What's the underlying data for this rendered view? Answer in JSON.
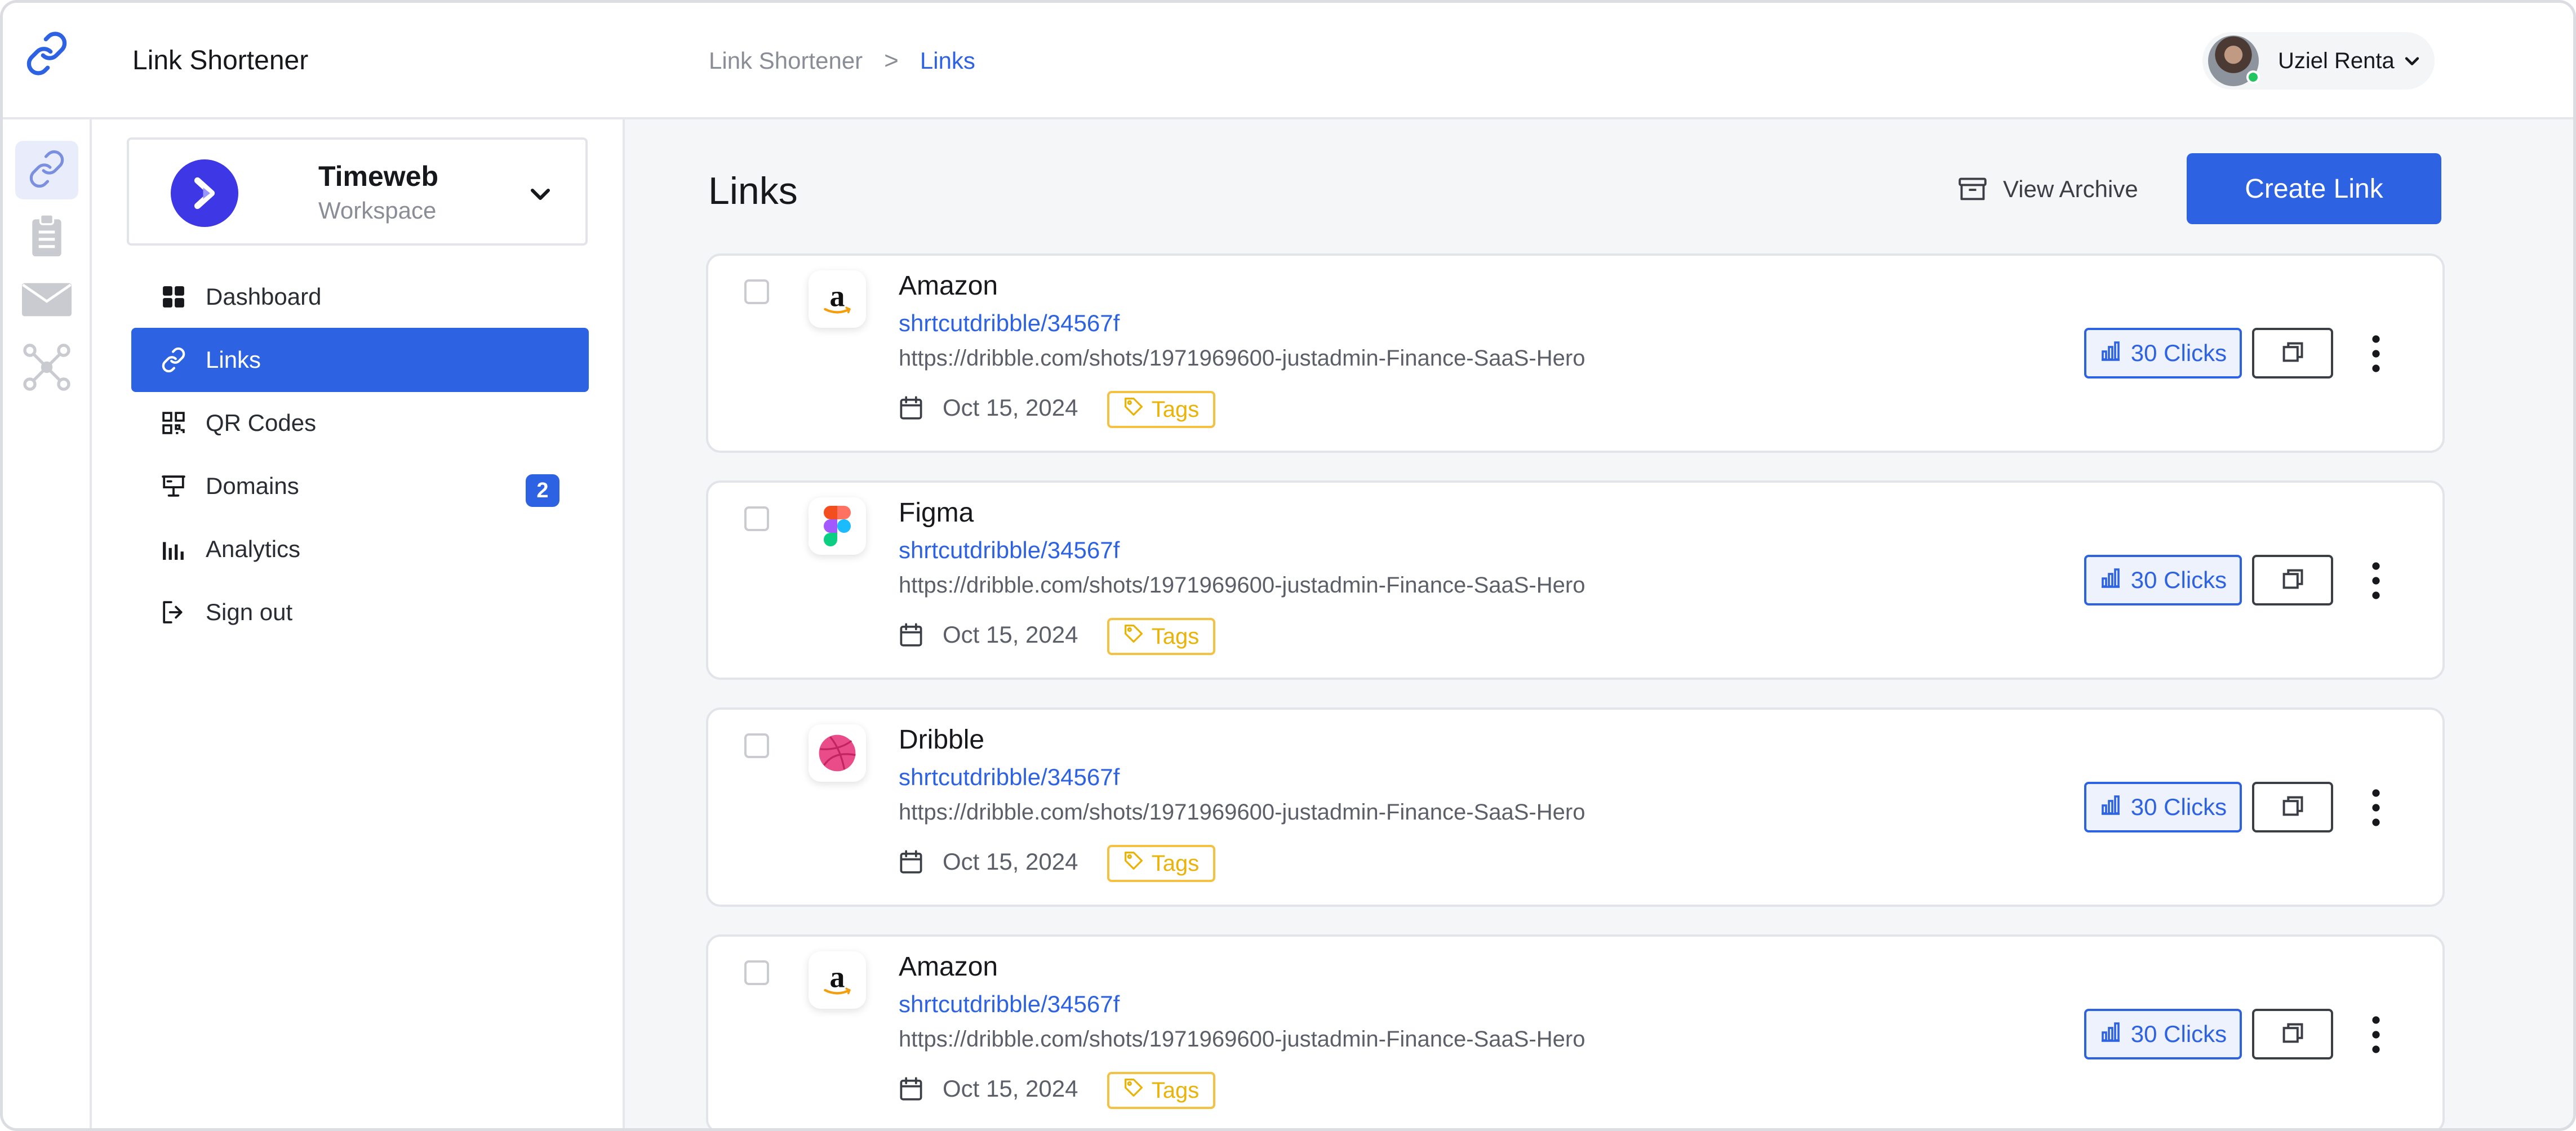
{
  "app": {
    "title": "Link Shortener"
  },
  "breadcrumb": {
    "root": "Link Shortener",
    "separator": ">",
    "current": "Links"
  },
  "user": {
    "name": "Uziel Renta",
    "status": "online"
  },
  "rail": {
    "items": [
      "link-icon",
      "clipboard-icon",
      "mail-icon",
      "network-icon"
    ]
  },
  "workspace": {
    "name": "Timeweb",
    "subtitle": "Workspace"
  },
  "sidebar": {
    "items": [
      {
        "label": "Dashboard",
        "icon": "grid-icon"
      },
      {
        "label": "Links",
        "icon": "link-icon",
        "active": true
      },
      {
        "label": "QR Codes",
        "icon": "qr-icon"
      },
      {
        "label": "Domains",
        "icon": "domain-icon",
        "badge": "2"
      },
      {
        "label": "Analytics",
        "icon": "bar-chart-icon"
      },
      {
        "label": "Sign out",
        "icon": "sign-out-icon"
      }
    ]
  },
  "main": {
    "title": "Links",
    "archive_label": "View Archive",
    "create_label": "Create Link"
  },
  "links": [
    {
      "name": "Amazon",
      "short": "shrtcutdribble/34567f",
      "url": "https://dribble.com/shots/1971969600-justadmin-Finance-SaaS-Hero",
      "date": "Oct 15, 2024",
      "tag": "Tags",
      "clicks": "30 Clicks",
      "icon": "amazon-icon"
    },
    {
      "name": "Figma",
      "short": "shrtcutdribble/34567f",
      "url": "https://dribble.com/shots/1971969600-justadmin-Finance-SaaS-Hero",
      "date": "Oct 15, 2024",
      "tag": "Tags",
      "clicks": "30 Clicks",
      "icon": "figma-icon"
    },
    {
      "name": "Dribble",
      "short": "shrtcutdribble/34567f",
      "url": "https://dribble.com/shots/1971969600-justadmin-Finance-SaaS-Hero",
      "date": "Oct 15, 2024",
      "tag": "Tags",
      "clicks": "30 Clicks",
      "icon": "dribbble-icon"
    },
    {
      "name": "Amazon",
      "short": "shrtcutdribble/34567f",
      "url": "https://dribble.com/shots/1971969600-justadmin-Finance-SaaS-Hero",
      "date": "Oct 15, 2024",
      "tag": "Tags",
      "clicks": "30 Clicks",
      "icon": "amazon-icon"
    }
  ],
  "colors": {
    "accent": "#2d62e2",
    "tag": "#eab308",
    "workspace_logo": "#3d37e6",
    "dribbble": "#ea4c89"
  }
}
